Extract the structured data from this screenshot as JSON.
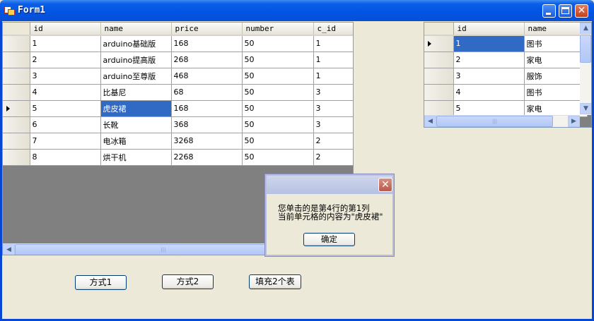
{
  "window": {
    "title": "Form1"
  },
  "grid_main": {
    "columns": [
      "id",
      "name",
      "price",
      "number",
      "c_id"
    ],
    "rows": [
      [
        "1",
        "arduino基础版",
        "168",
        "50",
        "1"
      ],
      [
        "2",
        "arduino提高版",
        "268",
        "50",
        "1"
      ],
      [
        "3",
        "arduino至尊版",
        "468",
        "50",
        "1"
      ],
      [
        "4",
        "比基尼",
        "68",
        "50",
        "3"
      ],
      [
        "5",
        "虎皮裙",
        "168",
        "50",
        "3"
      ],
      [
        "6",
        "长靴",
        "368",
        "50",
        "3"
      ],
      [
        "7",
        "电冰箱",
        "3268",
        "50",
        "2"
      ],
      [
        "8",
        "烘干机",
        "2268",
        "50",
        "2"
      ]
    ],
    "current_row_index": 4,
    "selected_cell": {
      "row": 4,
      "col": 1
    }
  },
  "grid_side": {
    "columns": [
      "id",
      "name"
    ],
    "rows": [
      [
        "1",
        "图书"
      ],
      [
        "2",
        "家电"
      ],
      [
        "3",
        "服饰"
      ],
      [
        "4",
        "图书"
      ],
      [
        "5",
        "家电"
      ]
    ],
    "current_row_index": 0,
    "selected_cell": {
      "row": 0,
      "col": 0
    }
  },
  "buttons": {
    "mode1": "方式1",
    "mode2": "方式2",
    "fill_two": "填充2个表"
  },
  "message_box": {
    "line1": "您单击的是第4行的第1列",
    "line2": "当前单元格的内容为\"虎皮裙\"",
    "ok": "确定"
  },
  "icons": {
    "app": "form-app-icon",
    "minimize": "minimize-icon",
    "maximize": "maximize-icon",
    "close": "close-icon",
    "scroll_left": "arrow-left-icon",
    "scroll_right": "arrow-right-icon",
    "scroll_up": "arrow-up-icon",
    "scroll_down": "arrow-down-icon"
  },
  "colors": {
    "titlebar": "#0054e3",
    "selection": "#316ac5",
    "form_bg": "#ece9d8",
    "grid_bg": "#808080"
  }
}
